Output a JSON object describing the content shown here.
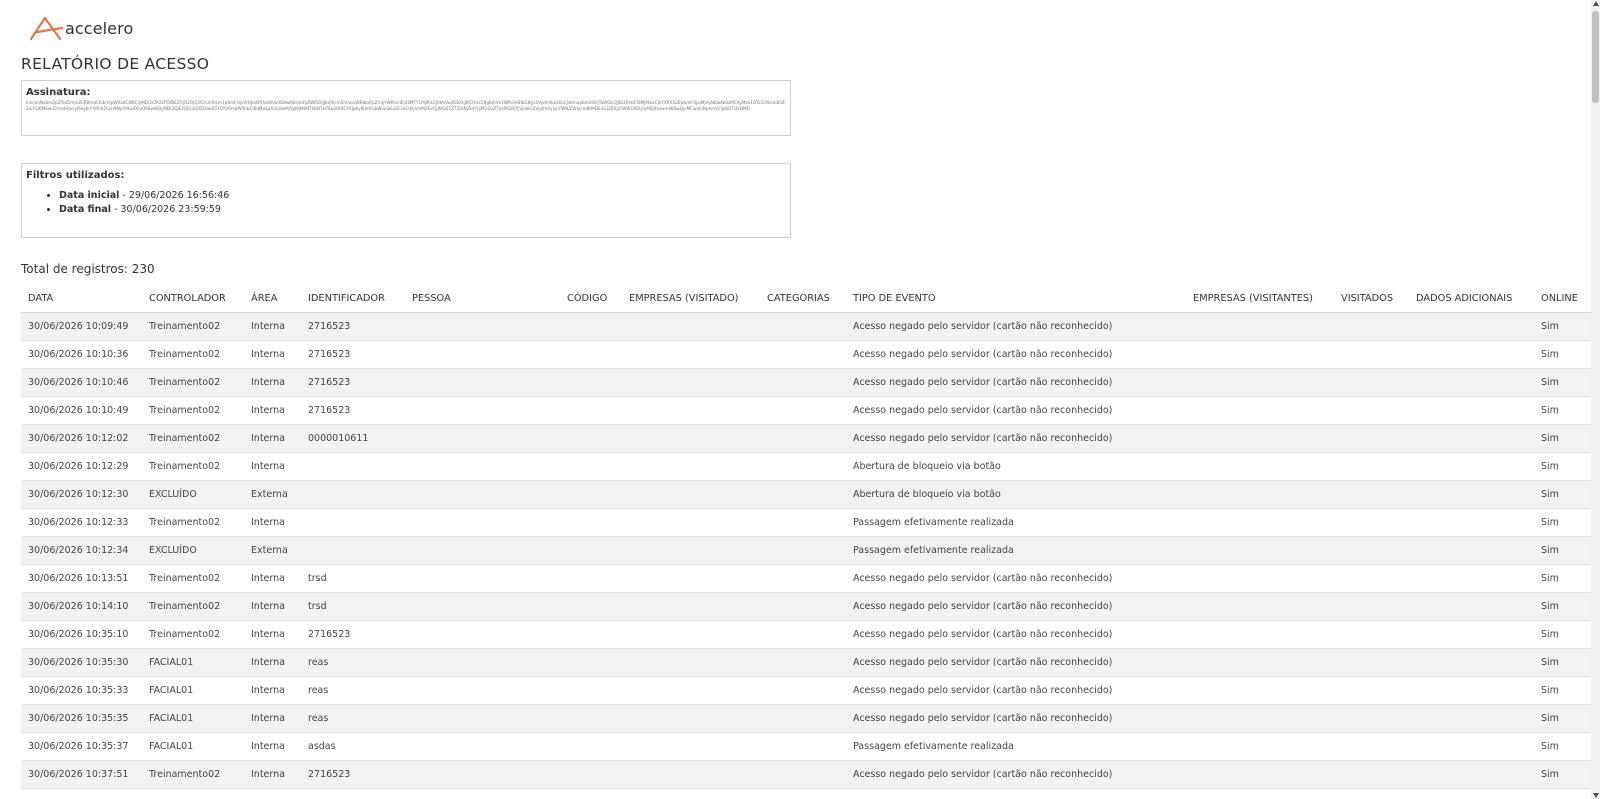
{
  "brand": {
    "name": "accelero",
    "accent": "#e8744a"
  },
  "report": {
    "title": "RELATÓRIO DE ACESSO"
  },
  "signature": {
    "label": "Assinatura:",
    "value": "InkcimNxbmZpZTsxDmJnZkR8mdC6lbmlpWRadC8lKCIyMDI2LTA2LTI5IDE2OjU2OjQ2lCIsInRlcm1pbmFsIjoiVHJlaW5hbWVudG8wMiIsImFyZWEiOiJJbnRlcm5hIiwiaWRlbnRpZmljYWRvciI6IjI3MTY1MjMiLCJldmVudG8iOiJBY2Vzc28gbmVnYWRvIHBlbG8gc2Vydmlkb3IiLCJvbmxpbmUiOiJTaW0iLCJ0b3RhbCI6MjMwLCJkYXRhX2ZpbmFsIjoiMjAyNi0wNi0zMCAyMzo1OTo1OSIsInBhZ2luYSI6MSwiZmlsdHJvcyI6eyJkYXRhX2luaWNpYWwiOiIyOS8wNi8yMDI2IDE2OjU2OjQ2IiwiZGF0YV9maW5hbCI6IjMwLzA2LzIwMjYgMjM6NTk6NTkifSwidXN1YXJpbyI6ImFkbWluIiwiaGFzaCI6IjhmM2ExYjJjNGQ1ZTZmN2E4YjljMGQxZTJmM2E0YjVjIiwic2VydmVyIjoiYWNjZWxlcm8tMDEiLCJ2ZXJzYW8iOiI0LjIuMSJ9xcwmlIbSwQjvMCwcInNpemVcIjo6OTQxOMO"
  },
  "filters": {
    "label": "Filtros utilizados:",
    "items": [
      {
        "label": "Data inicial",
        "value": " - 29/06/2026 16:56:46"
      },
      {
        "label": "Data final",
        "value": " - 30/06/2026 23:59:59"
      }
    ]
  },
  "total": {
    "label": "Total de registros:",
    "count": "230"
  },
  "table": {
    "columns": [
      "DATA",
      "CONTROLADOR",
      "ÁREA",
      "IDENTIFICADOR",
      "PESSOA",
      "CÓDIGO",
      "EMPRESAS (VISITADO)",
      "CATEGORIAS",
      "TIPO DE EVENTO",
      "EMPRESAS (VISITANTES)",
      "VISITADOS",
      "DADOS ADICIONAIS",
      "ONLINE"
    ],
    "rows": [
      [
        "30/06/2026 10:09:49",
        "Treinamento02",
        "Interna",
        "2716523",
        "",
        "",
        "",
        "",
        "Acesso negado pelo servidor (cartão não reconhecido)",
        "",
        "",
        "",
        "Sim"
      ],
      [
        "30/06/2026 10:10:36",
        "Treinamento02",
        "Interna",
        "2716523",
        "",
        "",
        "",
        "",
        "Acesso negado pelo servidor (cartão não reconhecido)",
        "",
        "",
        "",
        "Sim"
      ],
      [
        "30/06/2026 10:10:46",
        "Treinamento02",
        "Interna",
        "2716523",
        "",
        "",
        "",
        "",
        "Acesso negado pelo servidor (cartão não reconhecido)",
        "",
        "",
        "",
        "Sim"
      ],
      [
        "30/06/2026 10:10:49",
        "Treinamento02",
        "Interna",
        "2716523",
        "",
        "",
        "",
        "",
        "Acesso negado pelo servidor (cartão não reconhecido)",
        "",
        "",
        "",
        "Sim"
      ],
      [
        "30/06/2026 10:12:02",
        "Treinamento02",
        "Interna",
        "0000010611",
        "",
        "",
        "",
        "",
        "Acesso negado pelo servidor (cartão não reconhecido)",
        "",
        "",
        "",
        "Sim"
      ],
      [
        "30/06/2026 10:12:29",
        "Treinamento02",
        "Interna",
        "",
        "",
        "",
        "",
        "",
        "Abertura de bloqueio via botão",
        "",
        "",
        "",
        "Sim"
      ],
      [
        "30/06/2026 10:12:30",
        "EXCLUÍDO",
        "Externa",
        "",
        "",
        "",
        "",
        "",
        "Abertura de bloqueio via botão",
        "",
        "",
        "",
        "Sim"
      ],
      [
        "30/06/2026 10:12:33",
        "Treinamento02",
        "Interna",
        "",
        "",
        "",
        "",
        "",
        "Passagem efetivamente realizada",
        "",
        "",
        "",
        "Sim"
      ],
      [
        "30/06/2026 10:12:34",
        "EXCLUÍDO",
        "Externa",
        "",
        "",
        "",
        "",
        "",
        "Passagem efetivamente realizada",
        "",
        "",
        "",
        "Sim"
      ],
      [
        "30/06/2026 10:13:51",
        "Treinamento02",
        "Interna",
        "trsd",
        "",
        "",
        "",
        "",
        "Acesso negado pelo servidor (cartão não reconhecido)",
        "",
        "",
        "",
        "Sim"
      ],
      [
        "30/06/2026 10:14:10",
        "Treinamento02",
        "Interna",
        "trsd",
        "",
        "",
        "",
        "",
        "Acesso negado pelo servidor (cartão não reconhecido)",
        "",
        "",
        "",
        "Sim"
      ],
      [
        "30/06/2026 10:35:10",
        "Treinamento02",
        "Interna",
        "2716523",
        "",
        "",
        "",
        "",
        "Acesso negado pelo servidor (cartão não reconhecido)",
        "",
        "",
        "",
        "Sim"
      ],
      [
        "30/06/2026 10:35:30",
        "FACIAL01",
        "Interna",
        "reas",
        "",
        "",
        "",
        "",
        "Acesso negado pelo servidor (cartão não reconhecido)",
        "",
        "",
        "",
        "Sim"
      ],
      [
        "30/06/2026 10:35:33",
        "FACIAL01",
        "Interna",
        "reas",
        "",
        "",
        "",
        "",
        "Acesso negado pelo servidor (cartão não reconhecido)",
        "",
        "",
        "",
        "Sim"
      ],
      [
        "30/06/2026 10:35:35",
        "FACIAL01",
        "Interna",
        "reas",
        "",
        "",
        "",
        "",
        "Acesso negado pelo servidor (cartão não reconhecido)",
        "",
        "",
        "",
        "Sim"
      ],
      [
        "30/06/2026 10:35:37",
        "FACIAL01",
        "Interna",
        "asdas",
        "",
        "",
        "",
        "",
        "Passagem efetivamente realizada",
        "",
        "",
        "",
        "Sim"
      ],
      [
        "30/06/2026 10:37:51",
        "Treinamento02",
        "Interna",
        "2716523",
        "",
        "",
        "",
        "",
        "Acesso negado pelo servidor (cartão não reconhecido)",
        "",
        "",
        "",
        "Sim"
      ]
    ]
  },
  "icons": {
    "logo": "accelero-logo-icon"
  }
}
